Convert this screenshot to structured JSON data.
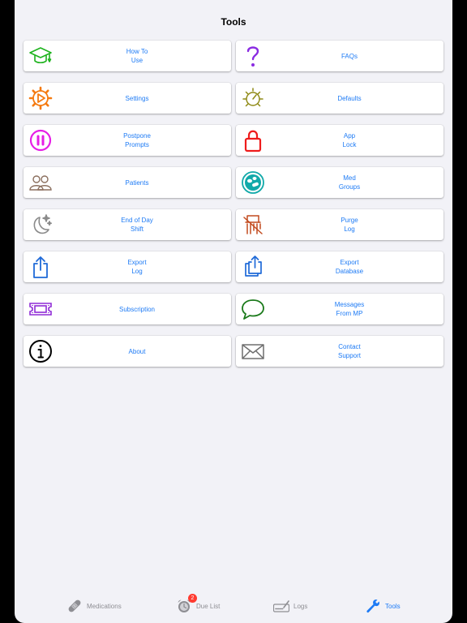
{
  "header": {
    "title": "Tools"
  },
  "tools": [
    {
      "label": "How To\nUse",
      "icon": "graduation-cap-icon",
      "color": "#1db31d"
    },
    {
      "label": "FAQs",
      "icon": "question-mark-icon",
      "color": "#8a2be2"
    },
    {
      "label": "Settings",
      "icon": "gear-play-icon",
      "color": "#f57a10"
    },
    {
      "label": "Defaults",
      "icon": "sun-dial-icon",
      "color": "#8f8a16"
    },
    {
      "label": "Postpone\nPrompts",
      "icon": "pause-icon",
      "color": "#e61ee6"
    },
    {
      "label": "App\nLock",
      "icon": "padlock-icon",
      "color": "#ee1c1c"
    },
    {
      "label": "Patients",
      "icon": "people-icon",
      "color": "#8b6f5e"
    },
    {
      "label": "Med\nGroups",
      "icon": "pills-icon",
      "color": "#11a9a9"
    },
    {
      "label": "End of Day\nShift",
      "icon": "moon-stars-icon",
      "color": "#8a8a8a"
    },
    {
      "label": "Purge\nLog",
      "icon": "shredder-icon",
      "color": "#c24a1e"
    },
    {
      "label": "Export\nLog",
      "icon": "share-icon",
      "color": "#1f6ad8"
    },
    {
      "label": "Export\nDatabase",
      "icon": "share-stack-icon",
      "color": "#1f6ad8"
    },
    {
      "label": "Subscription",
      "icon": "ticket-icon",
      "color": "#8f2bd6"
    },
    {
      "label": "Messages\nFrom MP",
      "icon": "chat-bubble-icon",
      "color": "#1b7a1b"
    },
    {
      "label": "About",
      "icon": "info-icon",
      "color": "#000000"
    },
    {
      "label": "Contact\nSupport",
      "icon": "envelope-icon",
      "color": "#6e6e6e"
    }
  ],
  "tabbar": {
    "items": [
      {
        "label": "Medications",
        "icon": "bandage-icon"
      },
      {
        "label": "Due List",
        "icon": "alarm-clock-icon",
        "badge": "2"
      },
      {
        "label": "Logs",
        "icon": "signature-icon"
      },
      {
        "label": "Tools",
        "icon": "wrench-icon",
        "active": true
      }
    ]
  },
  "colors": {
    "accent": "#1e7bf5",
    "inactive": "#8e8e93",
    "badge": "#ff3b30"
  }
}
